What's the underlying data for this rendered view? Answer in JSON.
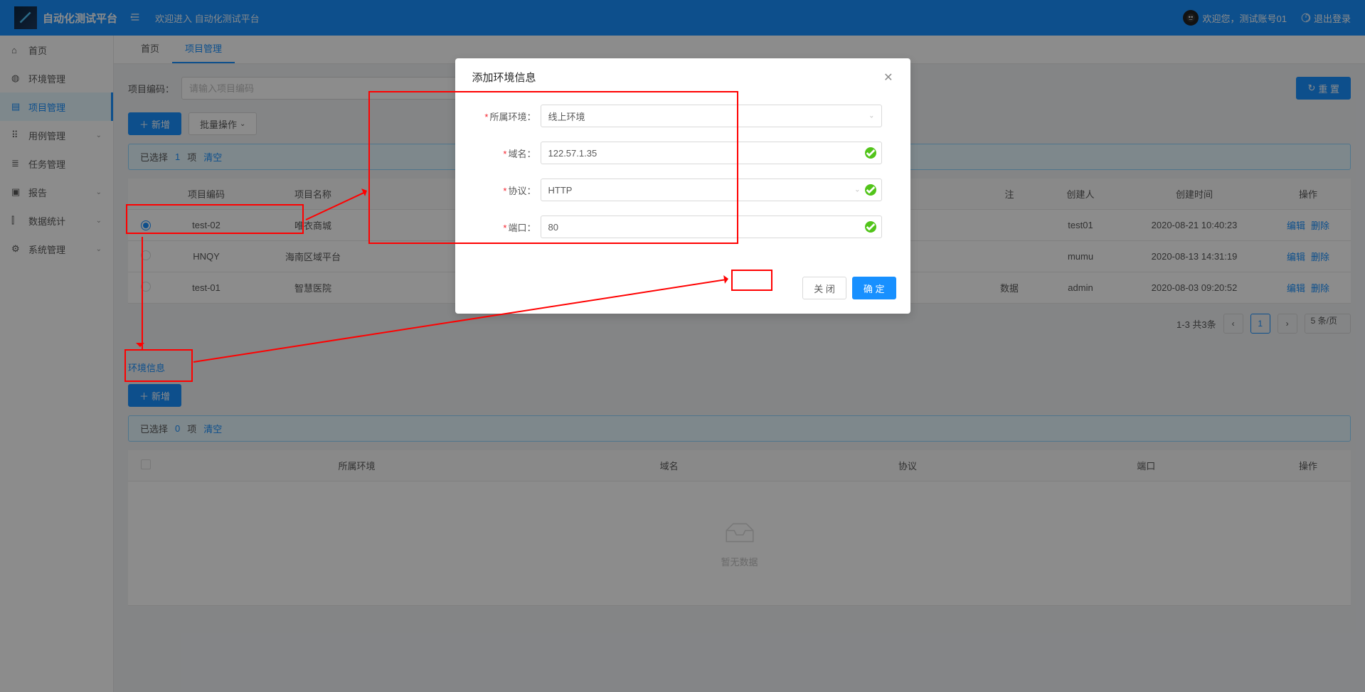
{
  "header": {
    "logo_text": "自动化测试平台",
    "welcome": "欢迎进入 自动化测试平台",
    "user_greeting": "欢迎您，测试账号01",
    "logout": "退出登录"
  },
  "sidebar": {
    "items": [
      {
        "icon": "home",
        "label": "首页",
        "expandable": false
      },
      {
        "icon": "globe",
        "label": "环境管理",
        "expandable": false
      },
      {
        "icon": "project",
        "label": "项目管理",
        "expandable": false,
        "active": true
      },
      {
        "icon": "case",
        "label": "用例管理",
        "expandable": true
      },
      {
        "icon": "task",
        "label": "任务管理",
        "expandable": false
      },
      {
        "icon": "report",
        "label": "报告",
        "expandable": true
      },
      {
        "icon": "stats",
        "label": "数据统计",
        "expandable": true
      },
      {
        "icon": "system",
        "label": "系统管理",
        "expandable": true
      }
    ]
  },
  "tabs": [
    {
      "label": "首页",
      "active": false
    },
    {
      "label": "项目管理",
      "active": true
    }
  ],
  "search": {
    "label": "项目编码：",
    "placeholder": "请输入项目编码",
    "reset_btn": "重 置"
  },
  "toolbar": {
    "add_btn": "新增",
    "batch_btn": "批量操作"
  },
  "project_alert": {
    "text_prefix": "已选择",
    "count": "1",
    "text_suffix": "项",
    "clear": "清空"
  },
  "project_table": {
    "headers": [
      "",
      "项目编码",
      "项目名称",
      "",
      "注",
      "创建人",
      "创建时间",
      "操作"
    ],
    "rows": [
      {
        "selected": true,
        "code": "test-02",
        "name": "唯衣商城",
        "col4": "",
        "note": "",
        "creator": "test01",
        "created": "2020-08-21 10:40:23",
        "edit": "编辑",
        "del": "删除"
      },
      {
        "selected": false,
        "code": "HNQY",
        "name": "海南区域平台",
        "col4": "",
        "note": "",
        "creator": "mumu",
        "created": "2020-08-13 14:31:19",
        "edit": "编辑",
        "del": "删除"
      },
      {
        "selected": false,
        "code": "test-01",
        "name": "智慧医院",
        "col4": "",
        "note": "数据",
        "creator": "admin",
        "created": "2020-08-03 09:20:52",
        "edit": "编辑",
        "del": "删除"
      }
    ]
  },
  "pagination": {
    "summary": "1-3 共3条",
    "page": "1",
    "per_page": "5 条/页"
  },
  "env_section": {
    "title": "环境信息",
    "add_btn": "新增"
  },
  "env_alert": {
    "text_prefix": "已选择",
    "count": "0",
    "text_suffix": "项",
    "clear": "清空"
  },
  "env_table": {
    "headers": [
      "",
      "所属环境",
      "域名",
      "协议",
      "端口",
      "操作"
    ],
    "empty": "暂无数据"
  },
  "modal": {
    "title": "添加环境信息",
    "fields": {
      "env": {
        "label": "所属环境：",
        "value": "线上环境"
      },
      "domain": {
        "label": "域名：",
        "value": "122.57.1.35"
      },
      "protocol": {
        "label": "协议：",
        "value": "HTTP"
      },
      "port": {
        "label": "端口：",
        "value": "80"
      }
    },
    "cancel_btn": "关 闭",
    "ok_btn": "确 定"
  }
}
